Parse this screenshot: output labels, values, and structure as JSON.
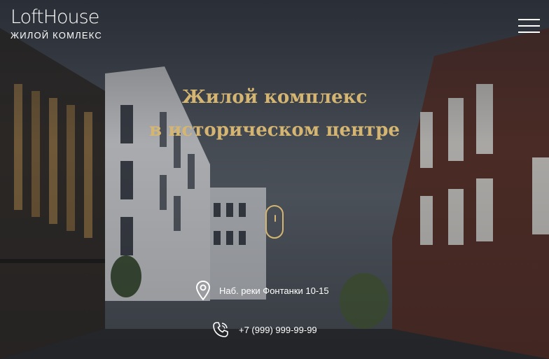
{
  "logo": {
    "title": "LoftHouse",
    "subtitle": "ЖИЛОЙ КОМЛЕКС"
  },
  "menu": {
    "icon": "hamburger-menu-icon"
  },
  "hero": {
    "headline_line1": "Жилой комплекс",
    "headline_line2": "в историческом центре",
    "scroll_icon": "mouse-scroll-icon"
  },
  "contacts": {
    "address": "Наб. реки Фонтанки 10-15",
    "address_icon": "location-pin-icon",
    "phone": "+7 (999) 999-99-99",
    "phone_icon": "phone-icon"
  },
  "colors": {
    "accent": "#d4b571",
    "text": "#ffffff",
    "background": "#2a2e35"
  }
}
